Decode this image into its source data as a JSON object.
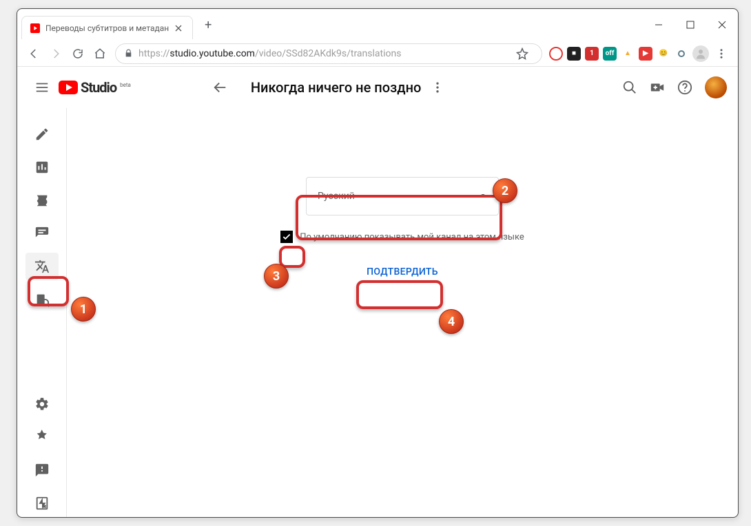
{
  "browser": {
    "tab_title": "Переводы субтитров и метадан",
    "url_proto": "https://",
    "url_host": "studio.youtube.com",
    "url_path": "/video/SSd82AKdk9s/translations"
  },
  "header": {
    "logo_text": "Studio",
    "logo_beta": "beta",
    "video_title": "Никогда ничего не поздно"
  },
  "main": {
    "language_value": "Русский",
    "checkbox_label": "По умолчанию показывать мой канал на этом языке",
    "confirm_label": "ПОДТВЕРДИТЬ"
  },
  "annotations": {
    "n1": "1",
    "n2": "2",
    "n3": "3",
    "n4": "4"
  }
}
